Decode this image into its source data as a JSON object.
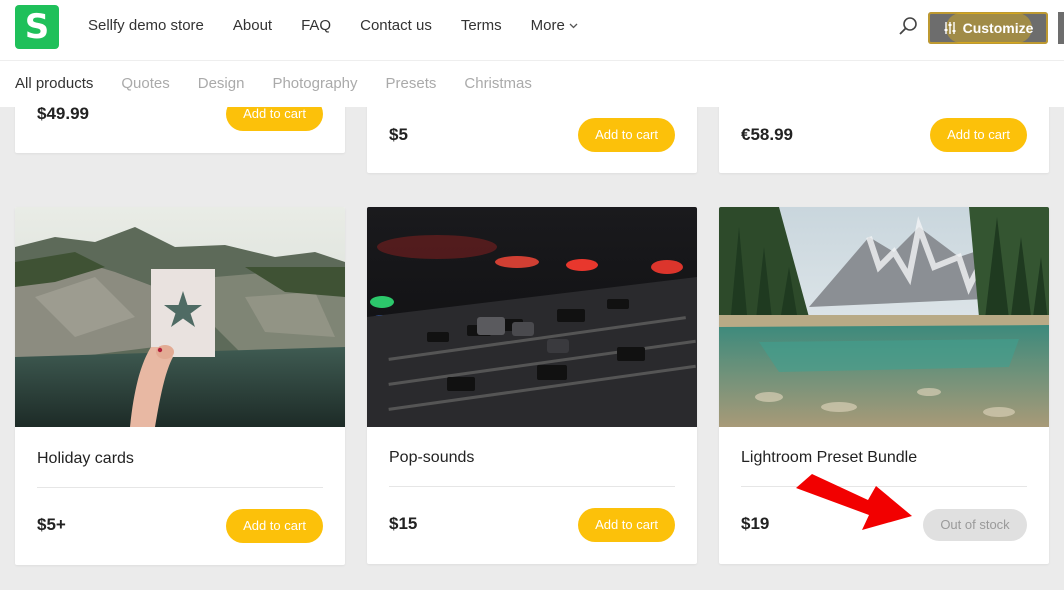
{
  "header": {
    "logo_letter": "S",
    "nav": [
      "Sellfy demo store",
      "About",
      "FAQ",
      "Contact us",
      "Terms",
      "More"
    ],
    "customize_label": "Customize"
  },
  "categories": [
    "All products",
    "Quotes",
    "Design",
    "Photography",
    "Presets",
    "Christmas"
  ],
  "top_row": [
    {
      "price": "$49.99",
      "button": "Add to cart"
    },
    {
      "price": "$5",
      "button": "Add to cart"
    },
    {
      "price": "€58.99",
      "button": "Add to cart"
    }
  ],
  "products": [
    {
      "title": "Holiday cards",
      "price": "$5+",
      "button": "Add to cart"
    },
    {
      "title": "Pop-sounds",
      "price": "$15",
      "button": "Add to cart"
    },
    {
      "title": "Lightroom Preset Bundle",
      "price": "$19",
      "button": "Out of stock"
    }
  ],
  "colors": {
    "brand": "#1fc05a",
    "accent": "#fcc10a",
    "annotation": "#f20000"
  }
}
